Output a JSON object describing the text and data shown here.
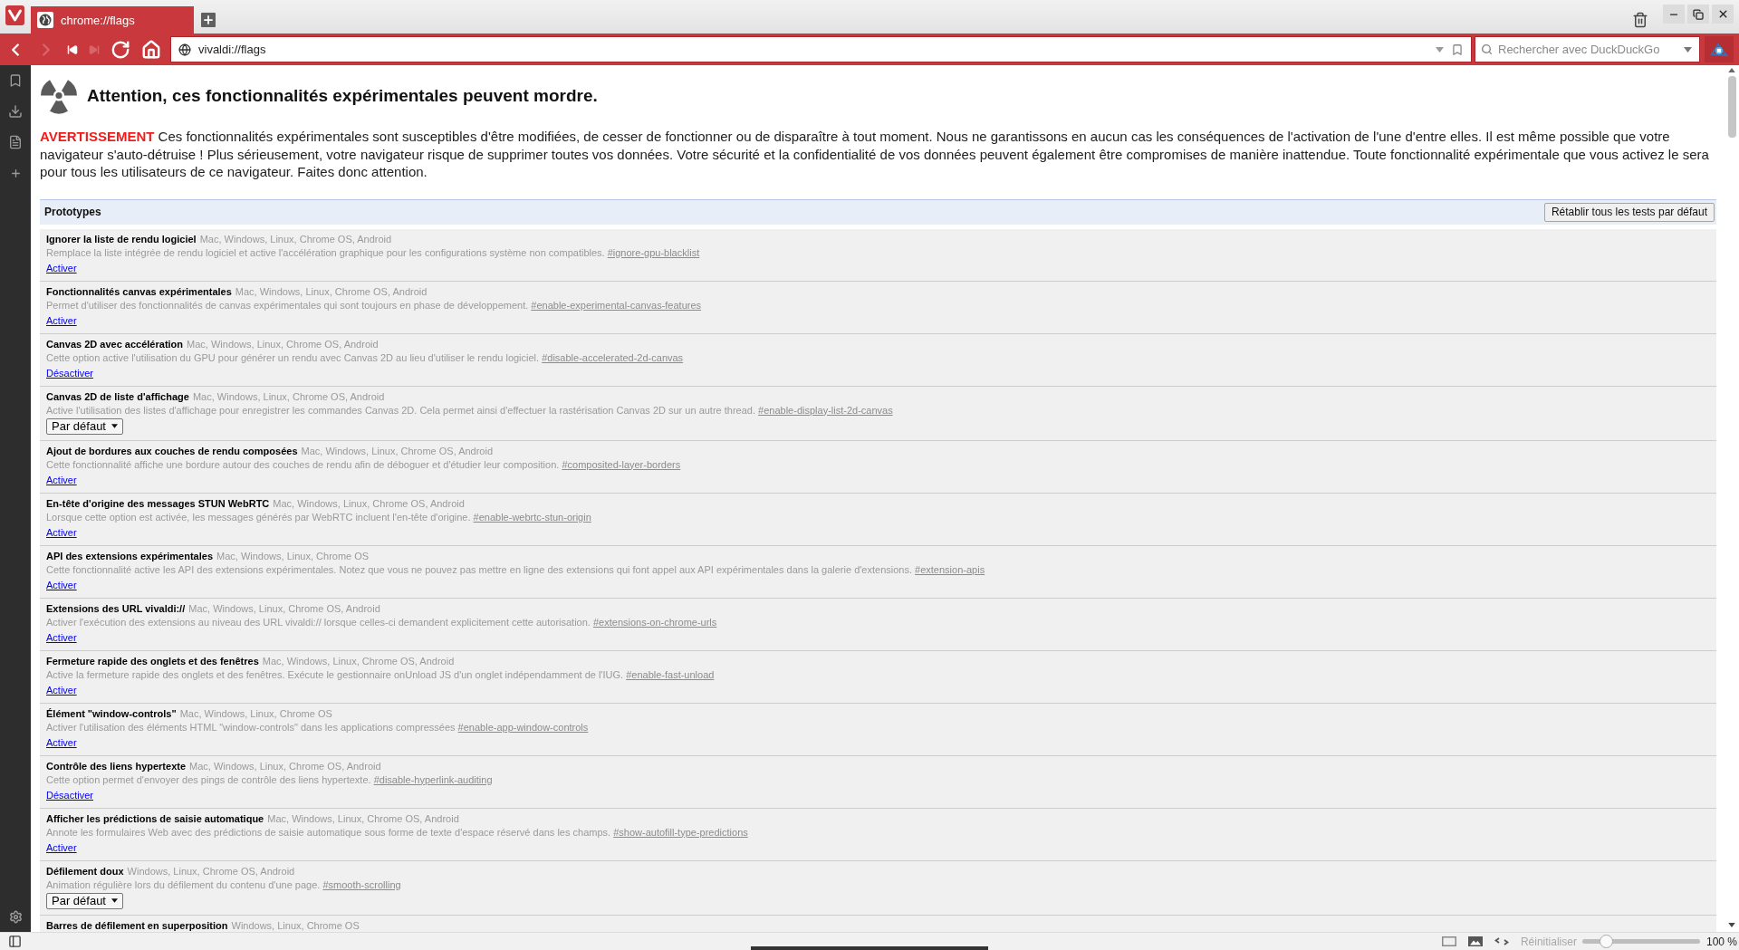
{
  "tabs": [
    {
      "title": "chrome://flags",
      "selected": true
    }
  ],
  "nav_buttons": [
    {
      "kind": "back",
      "disabled": false
    },
    {
      "kind": "forward",
      "disabled": true
    },
    {
      "kind": "rewind",
      "disabled": false
    },
    {
      "kind": "fast_forward",
      "disabled": true
    },
    {
      "kind": "reload",
      "disabled": false
    },
    {
      "kind": "home",
      "disabled": false
    }
  ],
  "address_bar": {
    "url": "vivaldi://flags"
  },
  "search_field": {
    "placeholder": "Rechercher avec DuckDuckGo"
  },
  "page": {
    "heading": "Attention, ces fonctionnalités expérimentales peuvent mordre.",
    "warning": "**AVERTISSEMENT** Ces fonctionnalités expérimentales sont susceptibles d'être modifiées, de cesser de fonctionner ou de disparaître à tout moment. Nous ne garantissons en aucun cas les conséquences de l'activation de l'une d'entre elles. Il est même possible que votre navigateur s'auto-détruise ! Plus sérieusement, votre navigateur risque de supprimer toutes vos données. Votre sécurité et la confidentialité de vos données peuvent également être compromises de manière inattendue. Toute fonctionnalité expérimentale que vous activez le sera pour tous les utilisateurs de ce navigateur. Faites donc attention."
  },
  "section": {
    "title": "Prototypes",
    "reset_button": "Rétablir tous les tests par défaut"
  },
  "flags": [
    {
      "title": "Ignorer la liste de rendu logiciel",
      "platforms": "Mac, Windows, Linux, Chrome OS, Android",
      "description": "Remplace la liste intégrée de rendu logiciel et active l'accélération graphique pour les configurations système non compatibles.",
      "anchor": "#ignore-gpu-blacklist",
      "control": {
        "kind": "link",
        "label": "Activer"
      }
    },
    {
      "title": "Fonctionnalités canvas expérimentales",
      "platforms": "Mac, Windows, Linux, Chrome OS, Android",
      "description": "Permet d'utiliser des fonctionnalités de canvas expérimentales qui sont toujours en phase de développement.",
      "anchor": "#enable-experimental-canvas-features",
      "control": {
        "kind": "link",
        "label": "Activer"
      }
    },
    {
      "title": "Canvas 2D avec accélération",
      "platforms": "Mac, Windows, Linux, Chrome OS, Android",
      "description": "Cette option active l'utilisation du GPU pour générer un rendu avec Canvas 2D au lieu d'utiliser le rendu logiciel.",
      "anchor": "#disable-accelerated-2d-canvas",
      "control": {
        "kind": "link",
        "label": "Désactiver"
      }
    },
    {
      "title": "Canvas 2D de liste d'affichage",
      "platforms": "Mac, Windows, Linux, Chrome OS, Android",
      "description": "Active l'utilisation des listes d'affichage pour enregistrer les commandes Canvas 2D. Cela permet ainsi d'effectuer la rastérisation Canvas 2D sur un autre thread.",
      "anchor": "#enable-display-list-2d-canvas",
      "control": {
        "kind": "select",
        "label": "Par défaut"
      }
    },
    {
      "title": "Ajout de bordures aux couches de rendu composées",
      "platforms": "Mac, Windows, Linux, Chrome OS, Android",
      "description": "Cette fonctionnalité affiche une bordure autour des couches de rendu afin de déboguer et d'étudier leur composition.",
      "anchor": "#composited-layer-borders",
      "control": {
        "kind": "link",
        "label": "Activer"
      }
    },
    {
      "title": "En-tête d'origine des messages STUN WebRTC",
      "platforms": "Mac, Windows, Linux, Chrome OS, Android",
      "description": "Lorsque cette option est activée, les messages générés par WebRTC incluent l'en-tête d'origine.",
      "anchor": "#enable-webrtc-stun-origin",
      "control": {
        "kind": "link",
        "label": "Activer"
      }
    },
    {
      "title": "API des extensions expérimentales",
      "platforms": "Mac, Windows, Linux, Chrome OS",
      "description": "Cette fonctionnalité active les API des extensions expérimentales. Notez que vous ne pouvez pas mettre en ligne des extensions qui font appel aux API expérimentales dans la galerie d'extensions.",
      "anchor": "#extension-apis",
      "control": {
        "kind": "link",
        "label": "Activer"
      }
    },
    {
      "title": "Extensions des URL vivaldi://",
      "platforms": "Mac, Windows, Linux, Chrome OS, Android",
      "description": "Activer l'exécution des extensions au niveau des URL vivaldi:// lorsque celles-ci demandent explicitement cette autorisation.",
      "anchor": "#extensions-on-chrome-urls",
      "control": {
        "kind": "link",
        "label": "Activer"
      }
    },
    {
      "title": "Fermeture rapide des onglets et des fenêtres",
      "platforms": "Mac, Windows, Linux, Chrome OS, Android",
      "description": "Active la fermeture rapide des onglets et des fenêtres. Exécute le gestionnaire onUnload JS d'un onglet indépendamment de l'IUG.",
      "anchor": "#enable-fast-unload",
      "control": {
        "kind": "link",
        "label": "Activer"
      }
    },
    {
      "title": "Élément \"window-controls\"",
      "platforms": "Mac, Windows, Linux, Chrome OS",
      "description": "Activer l'utilisation des éléments HTML \"window-controls\" dans les applications compressées",
      "anchor": "#enable-app-window-controls",
      "control": {
        "kind": "link",
        "label": "Activer"
      }
    },
    {
      "title": "Contrôle des liens hypertexte",
      "platforms": "Mac, Windows, Linux, Chrome OS, Android",
      "description": "Cette option permet d'envoyer des pings de contrôle des liens hypertexte.",
      "anchor": "#disable-hyperlink-auditing",
      "control": {
        "kind": "link",
        "label": "Désactiver"
      }
    },
    {
      "title": "Afficher les prédictions de saisie automatique",
      "platforms": "Mac, Windows, Linux, Chrome OS, Android",
      "description": "Annote les formulaires Web avec des prédictions de saisie automatique sous forme de texte d'espace réservé dans les champs.",
      "anchor": "#show-autofill-type-predictions",
      "control": {
        "kind": "link",
        "label": "Activer"
      }
    },
    {
      "title": "Défilement doux",
      "platforms": "Windows, Linux, Chrome OS, Android",
      "description": "Animation régulière lors du défilement du contenu d'une page.",
      "anchor": "#smooth-scrolling",
      "control": {
        "kind": "select",
        "label": "Par défaut"
      }
    },
    {
      "title": "Barres de défilement en superposition",
      "platforms": "Windows, Linux, Chrome OS"
    }
  ],
  "status_bar": {
    "reset": {
      "label": "Réinitialiser",
      "disabled": true
    },
    "zoom": {
      "level": 0.2
    },
    "zoom_reading": "100 %"
  }
}
